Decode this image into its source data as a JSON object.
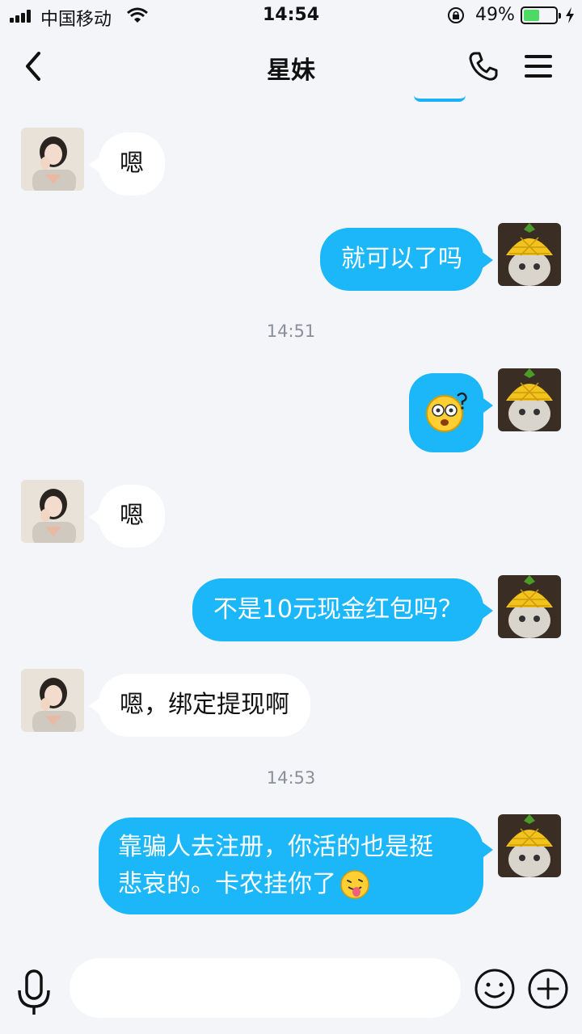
{
  "status_bar": {
    "carrier": "中国移动",
    "time": "14:54",
    "battery": "49%",
    "battery_level": 0.49
  },
  "header": {
    "title": "星妹",
    "back_icon": "chevron-left-icon",
    "call_icon": "phone-icon",
    "menu_icon": "hamburger-menu-icon"
  },
  "messages": [
    {
      "side": "in",
      "text": "嗯"
    },
    {
      "side": "out",
      "text": "就可以了吗"
    },
    {
      "side": "time",
      "text": "14:51"
    },
    {
      "side": "out",
      "sticker": "confused-face-emoji"
    },
    {
      "side": "in",
      "text": "嗯"
    },
    {
      "side": "out",
      "text": "不是10元现金红包吗？"
    },
    {
      "side": "in",
      "text": "嗯，绑定提现啊"
    },
    {
      "side": "time",
      "text": "14:53"
    },
    {
      "side": "out",
      "text_line1": "靠骗人去注册，你活的也是挺",
      "text_line2": "悲哀的。卡农挂你了",
      "emoji": "tongue-out-emoji"
    }
  ],
  "avatars": {
    "contact": "girl-photo-avatar",
    "self": "pineapple-hat-cat-avatar"
  },
  "input_bar": {
    "placeholder": "",
    "mic_icon": "microphone-icon",
    "emoji_icon": "smiley-icon",
    "plus_icon": "plus-circle-icon"
  },
  "colors": {
    "outgoing_bubble": "#1cb7f9",
    "incoming_bubble": "#ffffff",
    "background": "#f3f5f9"
  }
}
